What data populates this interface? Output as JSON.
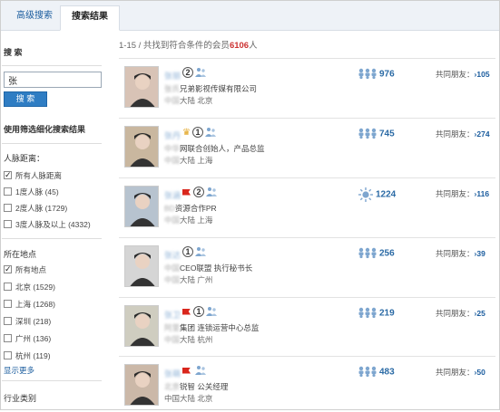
{
  "tabs": [
    {
      "label": "高级搜索",
      "active": false
    },
    {
      "label": "搜索结果",
      "active": true
    }
  ],
  "sidebar": {
    "search_title": "搜 索",
    "search_value": "张",
    "search_button": "搜 索",
    "filter_title": "使用筛选细化搜索结果",
    "distance": {
      "title": "人脉距离：",
      "options": [
        {
          "label": "所有人脉距离",
          "checked": true
        },
        {
          "label": "1度人脉 (45)",
          "checked": false
        },
        {
          "label": "2度人脉 (1729)",
          "checked": false
        },
        {
          "label": "3度人脉及以上 (4332)",
          "checked": false
        }
      ]
    },
    "location": {
      "title": "所在地点",
      "options": [
        {
          "label": "所有地点",
          "checked": true
        },
        {
          "label": "北京 (1529)",
          "checked": false
        },
        {
          "label": "上海 (1268)",
          "checked": false
        },
        {
          "label": "深圳 (218)",
          "checked": false
        },
        {
          "label": "广州 (136)",
          "checked": false
        },
        {
          "label": "杭州 (119)",
          "checked": false
        }
      ],
      "show_more": "显示更多"
    },
    "industry_title": "行业类别"
  },
  "results": {
    "summary_prefix": "1-15 / 共找到符合条件的会员",
    "summary_count": "6106",
    "summary_suffix": "人",
    "friends_label": "共同朋友：",
    "items": [
      {
        "name": "张丽",
        "degree": "2",
        "flag": false,
        "crown": false,
        "title_hidden": "张氏",
        "title": "兄弟影视传媒有限公司",
        "loc_hidden": "中国",
        "location": "大陆 北京",
        "count": "976",
        "count_icon": "people-icon",
        "friends": "105",
        "avatar_color": "#d8c3b6"
      },
      {
        "name": "张丹",
        "degree": "1",
        "flag": false,
        "crown": true,
        "title_hidden": "中华",
        "title": "网联合创始人，产品总监",
        "loc_hidden": "中国",
        "location": "大陆 上海",
        "count": "745",
        "count_icon": "people-icon",
        "friends": "274",
        "avatar_color": "#c9b79f"
      },
      {
        "name": "张涵",
        "degree": "2",
        "flag": true,
        "crown": false,
        "title_hidden": "BD",
        "title": "资源合作PR",
        "loc_hidden": "中国",
        "location": "大陆 上海",
        "count": "1224",
        "count_icon": "sun-icon",
        "friends": "116",
        "avatar_color": "#b7c3cf"
      },
      {
        "name": "张达",
        "degree": "1",
        "flag": false,
        "crown": false,
        "title_hidden": "中国",
        "title": "CEO联盟 执行秘书长",
        "loc_hidden": "中国",
        "location": "大陆 广州",
        "count": "256",
        "count_icon": "people-icon",
        "friends": "39",
        "avatar_color": "#d5d5d5"
      },
      {
        "name": "张卫",
        "degree": "1",
        "flag": true,
        "crown": false,
        "title_hidden": "阿里",
        "title": "集团 连锁运营中心总监",
        "loc_hidden": "中国",
        "location": "大陆 杭州",
        "count": "219",
        "count_icon": "people-icon",
        "friends": "25",
        "avatar_color": "#cfcdc0"
      },
      {
        "name": "张萌",
        "degree": "",
        "flag": true,
        "crown": false,
        "title_hidden": "北京",
        "title": "锐智 公关经理",
        "loc_hidden": "",
        "location": "中国大陆 北京",
        "count": "483",
        "count_icon": "people-icon",
        "friends": "50",
        "avatar_color": "#cbb8a8"
      }
    ]
  },
  "colors": {
    "accent": "#1a5c9e",
    "count_red": "#c33",
    "button_blue": "#2f7dc3"
  }
}
